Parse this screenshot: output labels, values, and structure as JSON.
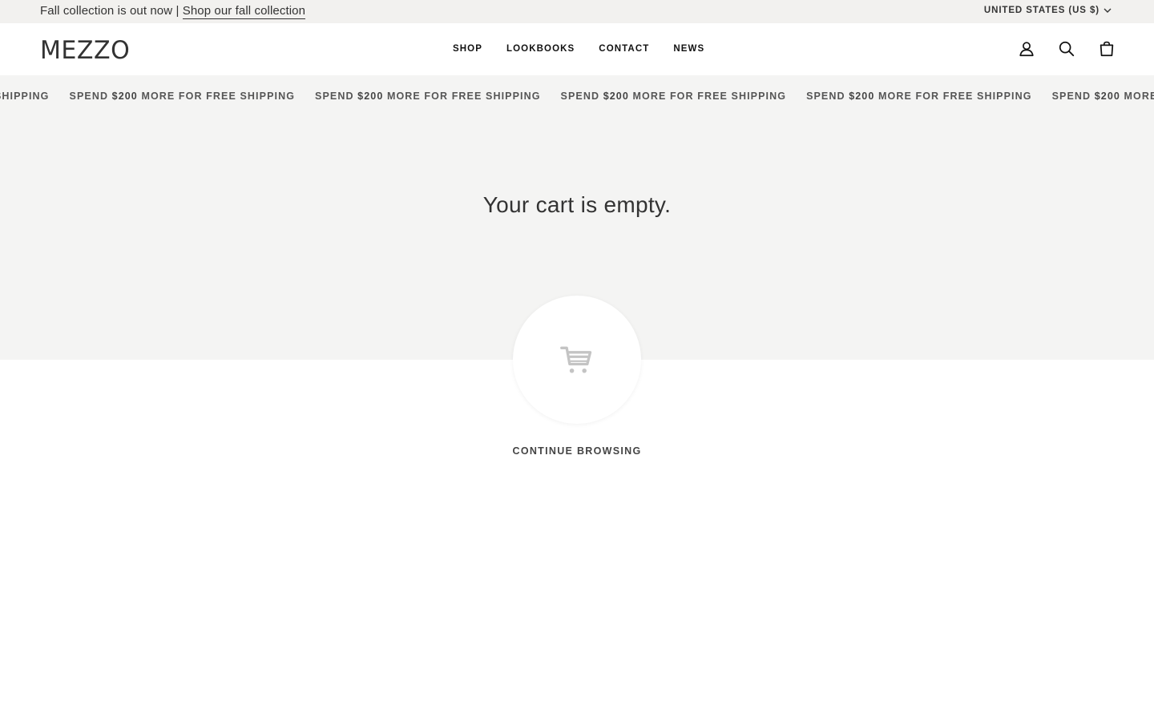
{
  "announcement": {
    "message": "Fall collection is out now | ",
    "link": "Shop our fall collection",
    "country": "UNITED STATES (US $)"
  },
  "header": {
    "logo": "MEZZO",
    "nav": [
      "SHOP",
      "LOOKBOOKS",
      "CONTACT",
      "NEWS"
    ],
    "icons": [
      "account-icon",
      "search-icon",
      "cart-icon"
    ]
  },
  "shipping_banner": {
    "prefix": "SPEND ",
    "amount": "$200",
    "suffix": " MORE FOR FREE SHIPPING"
  },
  "cart": {
    "heading": "Your cart is empty.",
    "continue_label": "CONTINUE BROWSING",
    "empty_icon": "shopping-cart-icon"
  },
  "colors": {
    "announcement_bg": "#f2f1ef",
    "banner_bg": "#f4f4f3",
    "text": "#333333"
  }
}
